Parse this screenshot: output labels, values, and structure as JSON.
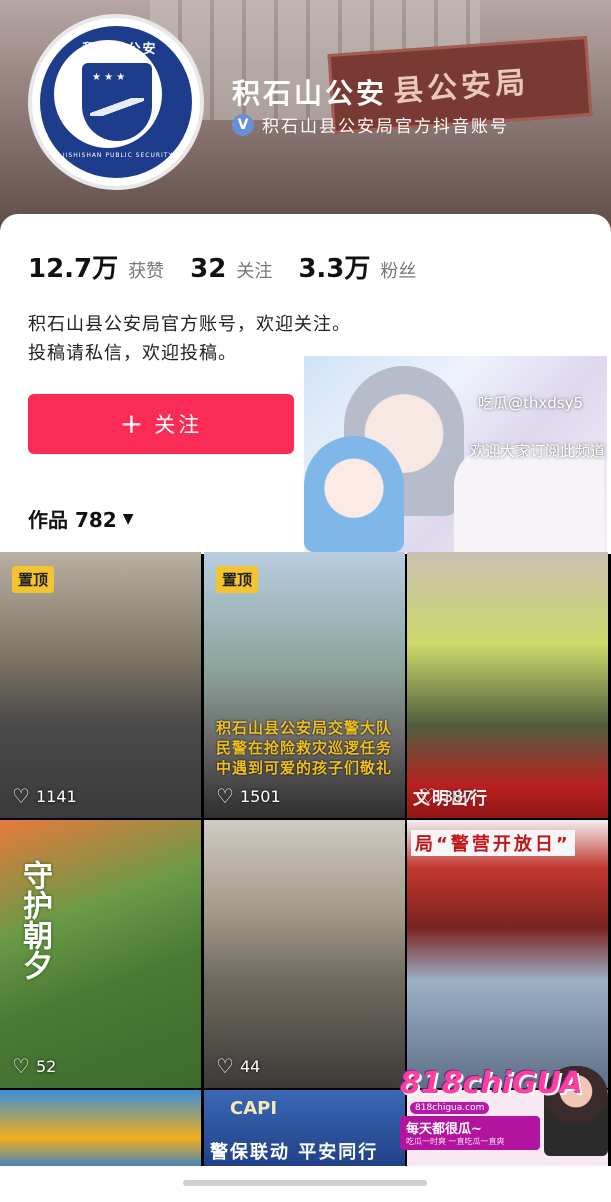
{
  "profile": {
    "name": "积石山公安",
    "verified_label": "积石山县公安局官方抖音账号",
    "verify_icon": "V",
    "header_sign_text": "县公安局",
    "avatar_top_text": "积石山公安",
    "avatar_bottom_text": "JISHISHAN PUBLIC SECURITY",
    "avatar_stars": "★ ★ ★"
  },
  "stats": {
    "likes_value": "12.7万",
    "likes_label": "获赞",
    "following_value": "32",
    "following_label": "关注",
    "fans_value": "3.3万",
    "fans_label": "粉丝"
  },
  "bio": {
    "line1": "积石山县公安局官方账号，欢迎关注。",
    "line2": "投稿请私信，欢迎投稿。"
  },
  "follow_button": {
    "plus": "+",
    "label": "关注"
  },
  "works": {
    "label": "作品 782",
    "caret": "▼"
  },
  "overlay_ad": {
    "text1": "吃瓜@thxdsy5",
    "text2": "欢迎大家订阅此频道"
  },
  "videos": [
    {
      "pinned": "置顶",
      "likes": "1141"
    },
    {
      "pinned": "置顶",
      "likes": "1501",
      "caption": "积石山县公安局交警大队民警在抢险救灾巡逻任务中遇到可爱的孩子们敬礼"
    },
    {
      "likes": "387",
      "caption": "文明出行"
    },
    {
      "likes": "52",
      "caption": "守护朝夕"
    },
    {
      "likes": "44"
    },
    {
      "caption": "局“警营开放日”"
    },
    {},
    {
      "caption_top": "CAPI",
      "caption_bottom": "警保联动 平安同行"
    },
    {}
  ],
  "corner_ad": {
    "logo": "818chiGUA",
    "url": "818chigua.com",
    "tag": "每天都很瓜~",
    "tag2": "吃瓜一时爽 一直吃瓜一直爽"
  },
  "colors": {
    "accent": "#fa2c55",
    "pin": "#f4c430",
    "avatar_blue": "#1d3d8c"
  }
}
